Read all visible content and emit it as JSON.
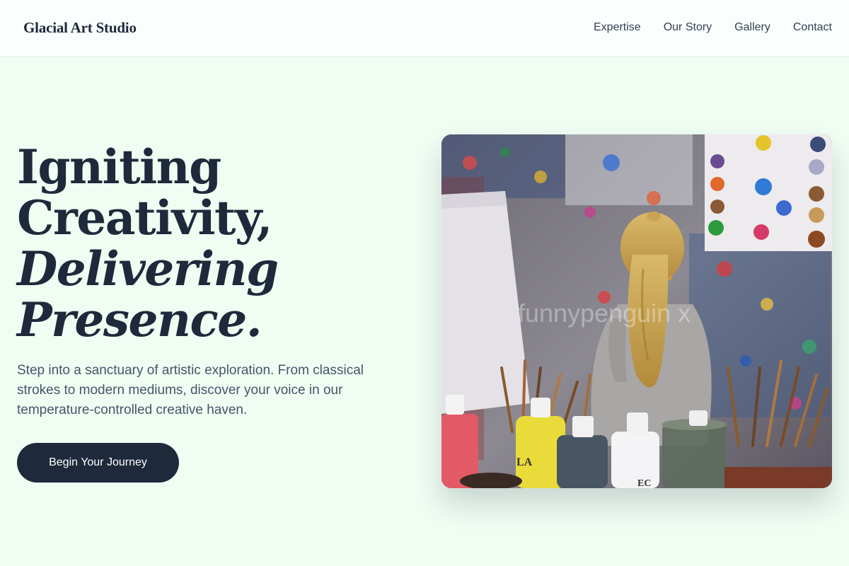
{
  "header": {
    "brand": "Glacial Art Studio",
    "nav": [
      {
        "label": "Expertise"
      },
      {
        "label": "Our Story"
      },
      {
        "label": "Gallery"
      },
      {
        "label": "Contact"
      }
    ]
  },
  "hero": {
    "title_line1": "Igniting",
    "title_line2": "Creativity,",
    "title_line3": "Delivering",
    "title_line4": "Presence.",
    "description": "Step into a sanctuary of artistic exploration. From classical strokes to modern mediums, discover your voice in our temperature-controlled creative haven.",
    "cta_label": "Begin Your Journey"
  },
  "image": {
    "watermark": "funnypenguin x",
    "jar_label_1": "LA",
    "jar_label_2": "EC"
  },
  "colors": {
    "background": "#effdf3",
    "header_bg": "#fcfefd",
    "primary": "#1e293b",
    "text_muted": "#475569"
  }
}
